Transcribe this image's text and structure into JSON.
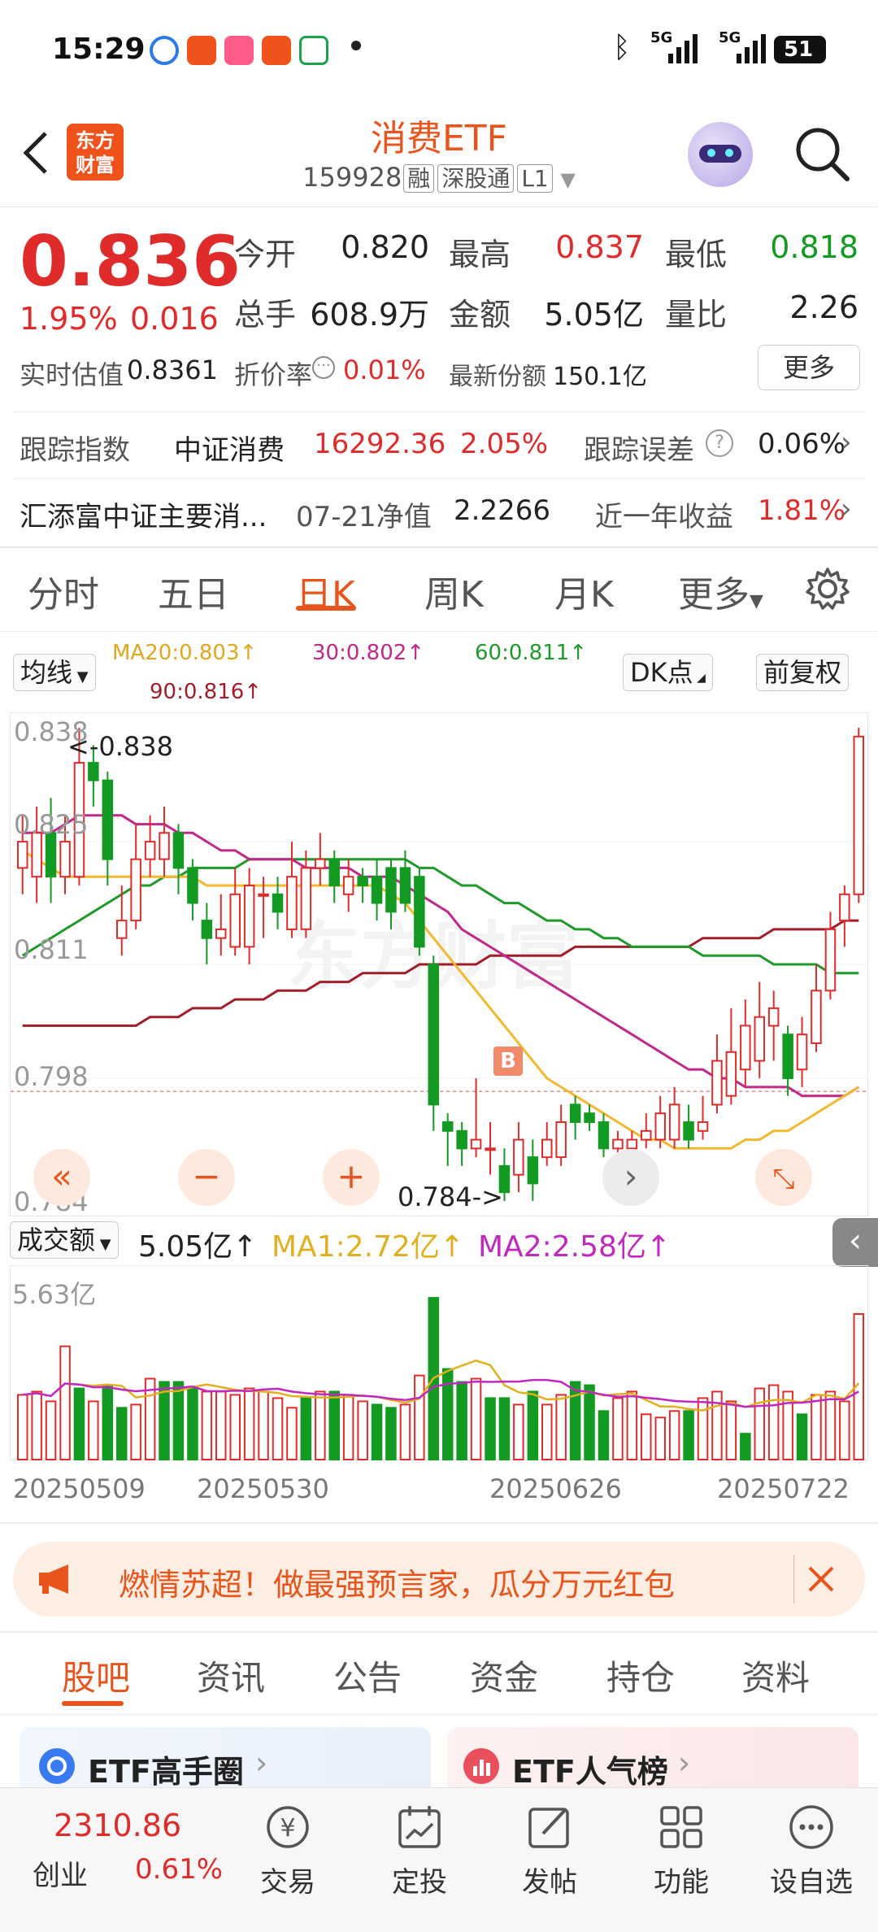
{
  "status_bar": {
    "time": "15:29",
    "network1": "5G",
    "network2": "5G",
    "battery": "51"
  },
  "header": {
    "back_icon": "chevron-left-icon",
    "logo_text": "东方财富",
    "title": "消费ETF",
    "code": "159928",
    "tags": [
      "融",
      "深股通",
      "L1"
    ],
    "search_icon": "search-icon"
  },
  "quote": {
    "price": "0.836",
    "change_pct": "1.95%",
    "change": "0.016",
    "open_label": "今开",
    "open": "0.820",
    "high_label": "最高",
    "high": "0.837",
    "low_label": "最低",
    "low": "0.818",
    "volume_label": "总手",
    "volume": "608.9万",
    "amount_label": "金额",
    "amount": "5.05亿",
    "ratio_label": "量比",
    "ratio": "2.26",
    "iopv_label": "实时估值",
    "iopv": "0.8361",
    "discount_label": "折价率",
    "discount": "0.01%",
    "shares_label": "最新份额",
    "shares": "150.1亿",
    "more_button": "更多"
  },
  "tracking": {
    "label": "跟踪指数",
    "index_name": "中证消费",
    "index_value": "16292.36",
    "index_pct": "2.05%",
    "error_label": "跟踪误差",
    "error_value": "0.06%"
  },
  "fund_row": {
    "name": "汇添富中证主要消...",
    "nav_label": "07-21净值",
    "nav": "2.2266",
    "return_label": "近一年收益",
    "return": "1.81%"
  },
  "chart_tabs": [
    "分时",
    "五日",
    "日K",
    "周K",
    "月K",
    "更多"
  ],
  "chart_tabs_active": 2,
  "chart_options": {
    "ma_selector": "均线",
    "ma20": "MA20:0.803↑",
    "ma30": "30:0.802↑",
    "ma60": "60:0.811↑",
    "ma90": "90:0.816↑",
    "dk_button": "DK点",
    "adjust_button": "前复权",
    "b_marker": "B"
  },
  "price_axis": {
    "p1": "0.838",
    "p2": "0.825",
    "p3": "0.811",
    "p4": "0.798",
    "p5": "0.784"
  },
  "annotations": {
    "max": "<-0.838",
    "min": "0.784->"
  },
  "volume_header": {
    "selector": "成交额",
    "value": "5.05亿↑",
    "ma1": "MA1:2.72亿↑",
    "ma2": "MA2:2.58亿↑",
    "axis_max": "5.63亿"
  },
  "dates": [
    "20250509",
    "20250530",
    "20250626",
    "20250722"
  ],
  "colors": {
    "up": "#e02b2b",
    "down": "#139a23",
    "ma20": "#f2b830",
    "ma30": "#c0288a",
    "ma60": "#1f9a2a",
    "ma90": "#a01e2a",
    "accent": "#e8541b"
  },
  "chart_data": {
    "type": "candlestick",
    "ylim": [
      0.784,
      0.838
    ],
    "candles": [
      {
        "o": 0.822,
        "c": 0.825,
        "h": 0.828,
        "l": 0.819
      },
      {
        "o": 0.821,
        "c": 0.826,
        "h": 0.829,
        "l": 0.818
      },
      {
        "o": 0.826,
        "c": 0.821,
        "h": 0.83,
        "l": 0.818
      },
      {
        "o": 0.821,
        "c": 0.825,
        "h": 0.828,
        "l": 0.819
      },
      {
        "o": 0.821,
        "c": 0.834,
        "h": 0.838,
        "l": 0.82
      },
      {
        "o": 0.834,
        "c": 0.832,
        "h": 0.836,
        "l": 0.829
      },
      {
        "o": 0.832,
        "c": 0.823,
        "h": 0.833,
        "l": 0.82
      },
      {
        "o": 0.814,
        "c": 0.816,
        "h": 0.82,
        "l": 0.812
      },
      {
        "o": 0.816,
        "c": 0.823,
        "h": 0.827,
        "l": 0.815
      },
      {
        "o": 0.823,
        "c": 0.825,
        "h": 0.828,
        "l": 0.821
      },
      {
        "o": 0.823,
        "c": 0.826,
        "h": 0.829,
        "l": 0.821
      },
      {
        "o": 0.826,
        "c": 0.822,
        "h": 0.827,
        "l": 0.819
      },
      {
        "o": 0.822,
        "c": 0.818,
        "h": 0.823,
        "l": 0.816
      },
      {
        "o": 0.816,
        "c": 0.814,
        "h": 0.818,
        "l": 0.811
      },
      {
        "o": 0.814,
        "c": 0.815,
        "h": 0.819,
        "l": 0.812
      },
      {
        "o": 0.813,
        "c": 0.819,
        "h": 0.822,
        "l": 0.812
      },
      {
        "o": 0.813,
        "c": 0.82,
        "h": 0.822,
        "l": 0.811
      },
      {
        "o": 0.819,
        "c": 0.819,
        "h": 0.821,
        "l": 0.814
      },
      {
        "o": 0.819,
        "c": 0.817,
        "h": 0.821,
        "l": 0.815
      },
      {
        "o": 0.815,
        "c": 0.821,
        "h": 0.825,
        "l": 0.814
      },
      {
        "o": 0.815,
        "c": 0.822,
        "h": 0.824,
        "l": 0.814
      },
      {
        "o": 0.822,
        "c": 0.823,
        "h": 0.826,
        "l": 0.82
      },
      {
        "o": 0.823,
        "c": 0.82,
        "h": 0.824,
        "l": 0.818
      },
      {
        "o": 0.819,
        "c": 0.821,
        "h": 0.823,
        "l": 0.817
      },
      {
        "o": 0.821,
        "c": 0.82,
        "h": 0.822,
        "l": 0.818
      },
      {
        "o": 0.821,
        "c": 0.818,
        "h": 0.823,
        "l": 0.816
      },
      {
        "o": 0.822,
        "c": 0.817,
        "h": 0.823,
        "l": 0.815
      },
      {
        "o": 0.822,
        "c": 0.818,
        "h": 0.824,
        "l": 0.817
      },
      {
        "o": 0.821,
        "c": 0.813,
        "h": 0.822,
        "l": 0.812
      },
      {
        "o": 0.811,
        "c": 0.795,
        "h": 0.812,
        "l": 0.792
      },
      {
        "o": 0.793,
        "c": 0.792,
        "h": 0.794,
        "l": 0.788
      },
      {
        "o": 0.792,
        "c": 0.79,
        "h": 0.793,
        "l": 0.788
      },
      {
        "o": 0.79,
        "c": 0.791,
        "h": 0.798,
        "l": 0.789
      },
      {
        "o": 0.79,
        "c": 0.79,
        "h": 0.793,
        "l": 0.787
      },
      {
        "o": 0.788,
        "c": 0.785,
        "h": 0.79,
        "l": 0.784
      },
      {
        "o": 0.787,
        "c": 0.791,
        "h": 0.793,
        "l": 0.785
      },
      {
        "o": 0.789,
        "c": 0.786,
        "h": 0.791,
        "l": 0.784
      },
      {
        "o": 0.789,
        "c": 0.791,
        "h": 0.793,
        "l": 0.788
      },
      {
        "o": 0.789,
        "c": 0.793,
        "h": 0.795,
        "l": 0.788
      },
      {
        "o": 0.795,
        "c": 0.793,
        "h": 0.796,
        "l": 0.791
      },
      {
        "o": 0.794,
        "c": 0.793,
        "h": 0.795,
        "l": 0.792
      },
      {
        "o": 0.793,
        "c": 0.79,
        "h": 0.794,
        "l": 0.789
      },
      {
        "o": 0.79,
        "c": 0.791,
        "h": 0.792,
        "l": 0.787
      },
      {
        "o": 0.79,
        "c": 0.791,
        "h": 0.792,
        "l": 0.789
      },
      {
        "o": 0.791,
        "c": 0.792,
        "h": 0.794,
        "l": 0.79
      },
      {
        "o": 0.791,
        "c": 0.794,
        "h": 0.796,
        "l": 0.79
      },
      {
        "o": 0.791,
        "c": 0.795,
        "h": 0.797,
        "l": 0.79
      },
      {
        "o": 0.793,
        "c": 0.791,
        "h": 0.795,
        "l": 0.79
      },
      {
        "o": 0.792,
        "c": 0.793,
        "h": 0.796,
        "l": 0.791
      },
      {
        "o": 0.795,
        "c": 0.8,
        "h": 0.803,
        "l": 0.794
      },
      {
        "o": 0.796,
        "c": 0.801,
        "h": 0.806,
        "l": 0.795
      },
      {
        "o": 0.799,
        "c": 0.804,
        "h": 0.807,
        "l": 0.797
      },
      {
        "o": 0.8,
        "c": 0.805,
        "h": 0.809,
        "l": 0.798
      },
      {
        "o": 0.804,
        "c": 0.806,
        "h": 0.808,
        "l": 0.8
      },
      {
        "o": 0.803,
        "c": 0.798,
        "h": 0.804,
        "l": 0.796
      },
      {
        "o": 0.799,
        "c": 0.803,
        "h": 0.805,
        "l": 0.797
      },
      {
        "o": 0.802,
        "c": 0.808,
        "h": 0.811,
        "l": 0.801
      },
      {
        "o": 0.808,
        "c": 0.815,
        "h": 0.817,
        "l": 0.807
      },
      {
        "o": 0.816,
        "c": 0.819,
        "h": 0.82,
        "l": 0.813
      },
      {
        "o": 0.819,
        "c": 0.837,
        "h": 0.838,
        "l": 0.818
      }
    ],
    "ma20": [
      0.824,
      0.823,
      0.822,
      0.821,
      0.821,
      0.821,
      0.821,
      0.821,
      0.821,
      0.821,
      0.821,
      0.821,
      0.821,
      0.82,
      0.82,
      0.82,
      0.82,
      0.82,
      0.82,
      0.82,
      0.82,
      0.82,
      0.82,
      0.82,
      0.82,
      0.82,
      0.819,
      0.818,
      0.816,
      0.814,
      0.812,
      0.81,
      0.808,
      0.806,
      0.804,
      0.802,
      0.8,
      0.798,
      0.797,
      0.796,
      0.795,
      0.794,
      0.793,
      0.792,
      0.791,
      0.791,
      0.79,
      0.79,
      0.79,
      0.79,
      0.79,
      0.791,
      0.791,
      0.792,
      0.792,
      0.793,
      0.794,
      0.795,
      0.796,
      0.797
    ],
    "ma30": [
      0.826,
      0.826,
      0.826,
      0.827,
      0.828,
      0.828,
      0.828,
      0.828,
      0.827,
      0.827,
      0.827,
      0.826,
      0.826,
      0.825,
      0.824,
      0.824,
      0.823,
      0.823,
      0.823,
      0.823,
      0.822,
      0.822,
      0.822,
      0.822,
      0.821,
      0.821,
      0.821,
      0.82,
      0.819,
      0.818,
      0.817,
      0.815,
      0.814,
      0.813,
      0.812,
      0.811,
      0.81,
      0.809,
      0.808,
      0.807,
      0.806,
      0.805,
      0.804,
      0.803,
      0.802,
      0.801,
      0.8,
      0.799,
      0.799,
      0.798,
      0.798,
      0.797,
      0.797,
      0.797,
      0.797,
      0.796,
      0.796,
      0.796,
      0.796,
      0.797
    ],
    "ma60": [
      0.812,
      0.813,
      0.814,
      0.815,
      0.816,
      0.817,
      0.818,
      0.819,
      0.82,
      0.82,
      0.821,
      0.821,
      0.822,
      0.822,
      0.822,
      0.822,
      0.823,
      0.823,
      0.823,
      0.823,
      0.823,
      0.823,
      0.823,
      0.823,
      0.823,
      0.823,
      0.823,
      0.823,
      0.822,
      0.822,
      0.821,
      0.82,
      0.82,
      0.819,
      0.818,
      0.818,
      0.817,
      0.816,
      0.816,
      0.815,
      0.815,
      0.814,
      0.814,
      0.813,
      0.813,
      0.813,
      0.813,
      0.813,
      0.812,
      0.812,
      0.812,
      0.812,
      0.812,
      0.811,
      0.811,
      0.811,
      0.811,
      0.81,
      0.81,
      0.81
    ],
    "ma90": [
      0.804,
      0.804,
      0.804,
      0.804,
      0.804,
      0.804,
      0.804,
      0.804,
      0.804,
      0.805,
      0.805,
      0.805,
      0.806,
      0.806,
      0.806,
      0.807,
      0.807,
      0.807,
      0.808,
      0.808,
      0.808,
      0.809,
      0.809,
      0.809,
      0.81,
      0.81,
      0.81,
      0.81,
      0.811,
      0.811,
      0.811,
      0.811,
      0.811,
      0.812,
      0.812,
      0.812,
      0.812,
      0.812,
      0.812,
      0.813,
      0.813,
      0.813,
      0.813,
      0.813,
      0.813,
      0.813,
      0.813,
      0.813,
      0.814,
      0.814,
      0.814,
      0.814,
      0.814,
      0.815,
      0.815,
      0.815,
      0.815,
      0.815,
      0.816,
      0.816
    ],
    "volume_ylim": [
      0,
      5.63
    ],
    "volume": [
      2.0,
      2.1,
      1.8,
      3.5,
      2.2,
      1.8,
      2.3,
      1.6,
      1.7,
      2.5,
      2.4,
      2.4,
      2.2,
      2.1,
      2.1,
      2.0,
      2.2,
      2.1,
      1.9,
      1.6,
      1.9,
      2.1,
      2.1,
      2.0,
      1.8,
      1.7,
      1.6,
      1.7,
      2.6,
      5.0,
      2.8,
      2.4,
      2.5,
      1.9,
      1.9,
      1.7,
      2.1,
      1.7,
      2.0,
      2.4,
      2.3,
      1.5,
      1.9,
      2.1,
      1.4,
      1.3,
      1.5,
      1.5,
      1.9,
      2.1,
      1.8,
      0.8,
      2.2,
      2.3,
      2.1,
      1.4,
      2.0,
      2.1,
      1.8,
      4.5
    ],
    "volume_up": [
      true,
      true,
      true,
      true,
      false,
      true,
      false,
      false,
      true,
      true,
      false,
      false,
      false,
      true,
      true,
      true,
      true,
      true,
      true,
      true,
      false,
      true,
      false,
      true,
      true,
      false,
      false,
      true,
      true,
      false,
      false,
      false,
      true,
      false,
      false,
      true,
      false,
      true,
      true,
      false,
      false,
      false,
      true,
      true,
      true,
      true,
      true,
      false,
      true,
      true,
      true,
      false,
      true,
      true,
      true,
      false,
      true,
      true,
      true,
      true
    ]
  },
  "banner": {
    "text": "燃情苏超！做最强预言家，瓜分万元红包"
  },
  "bottom_tabs": [
    "股吧",
    "资讯",
    "公告",
    "资金",
    "持仓",
    "资料"
  ],
  "cards": {
    "card1": "ETF高手圈",
    "card2": "ETF人气榜"
  },
  "bottom_nav": {
    "index_value": "2310.86",
    "index_name": "创业",
    "index_pct": "0.61%",
    "items": [
      "交易",
      "定投",
      "发帖",
      "功能",
      "设自选"
    ]
  }
}
